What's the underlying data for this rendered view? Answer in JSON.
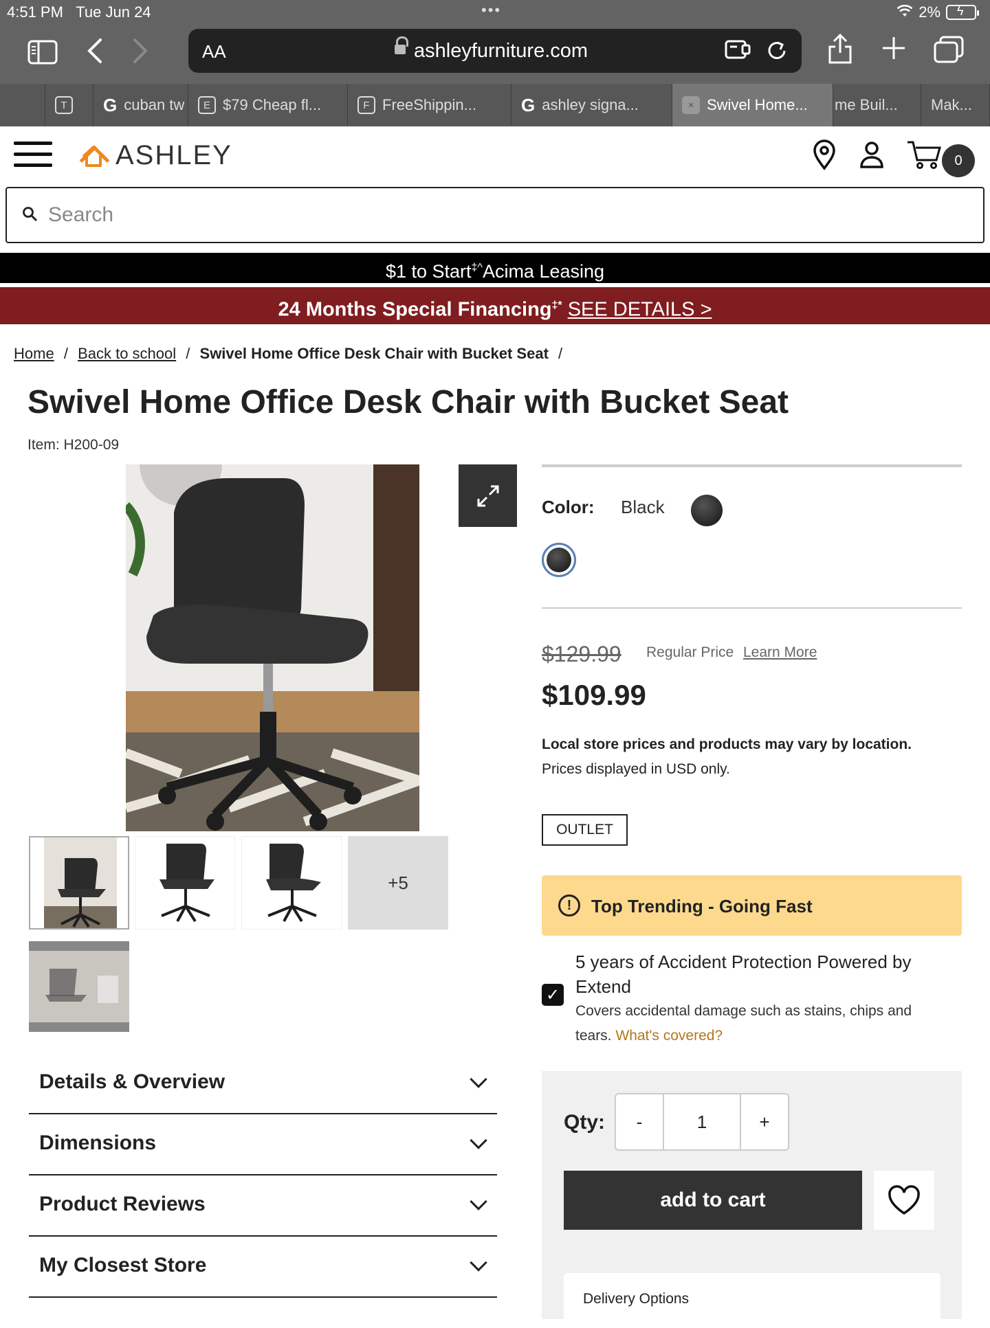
{
  "status_bar": {
    "time": "4:51 PM",
    "date": "Tue Jun 24",
    "battery": "2%"
  },
  "browser": {
    "aa_label": "AA",
    "domain": "ashleyfurniture.com",
    "tabs": [
      {
        "icon": "T",
        "label": ""
      },
      {
        "icon": "G",
        "label": "cuban tw"
      },
      {
        "icon": "E",
        "label": "$79 Cheap fl..."
      },
      {
        "icon": "F",
        "label": "FreeShippin..."
      },
      {
        "icon": "G",
        "label": "ashley signa..."
      },
      {
        "icon": "×",
        "label": "Swivel Home..."
      },
      {
        "icon": "",
        "label": "me Buil..."
      },
      {
        "icon": "",
        "label": "Mak..."
      }
    ]
  },
  "header": {
    "logo_text": "ASHLEY",
    "cart_count": "0"
  },
  "search": {
    "placeholder": "Search"
  },
  "promos": {
    "black_text": "$1 to Start",
    "black_sup": "‡^",
    "black_text2": "Acima Leasing",
    "red_text": "24 Months Special Financing",
    "red_sup": "‡*",
    "red_link": "SEE DETAILS >"
  },
  "breadcrumb": {
    "home": "Home",
    "category": "Back to school",
    "current": "Swivel Home Office Desk Chair with Bucket Seat",
    "sep": "/"
  },
  "product": {
    "title": "Swivel Home Office Desk Chair with Bucket Seat",
    "item": "Item: H200-09",
    "color_label": "Color:",
    "color_value": "Black",
    "old_price": "$129.99",
    "regular_price_label": "Regular Price",
    "learn_more": "Learn More",
    "price": "$109.99",
    "note_bold": "Local store prices and products may vary by location.",
    "note": "Prices displayed in USD only.",
    "outlet": "OUTLET",
    "trending": "Top Trending - Going Fast",
    "protection_title": "5 years of Accident Protection Powered by Extend",
    "protection_desc": "Covers accidental damage such as stains, chips and tears.",
    "protection_link": "What's covered?",
    "qty_label": "Qty:",
    "qty_minus": "-",
    "qty_value": "1",
    "qty_plus": "+",
    "add_to_cart": "add to cart",
    "delivery_label": "Delivery Options",
    "more_images": "+5"
  },
  "accordions": [
    "Details & Overview",
    "Dimensions",
    "Product Reviews",
    "My Closest Store"
  ],
  "colors": {
    "accent_red": "#7f1d20",
    "trending_bg": "#fdd98e",
    "logo_orange": "#f0871e",
    "link_gold": "#b5761b"
  }
}
